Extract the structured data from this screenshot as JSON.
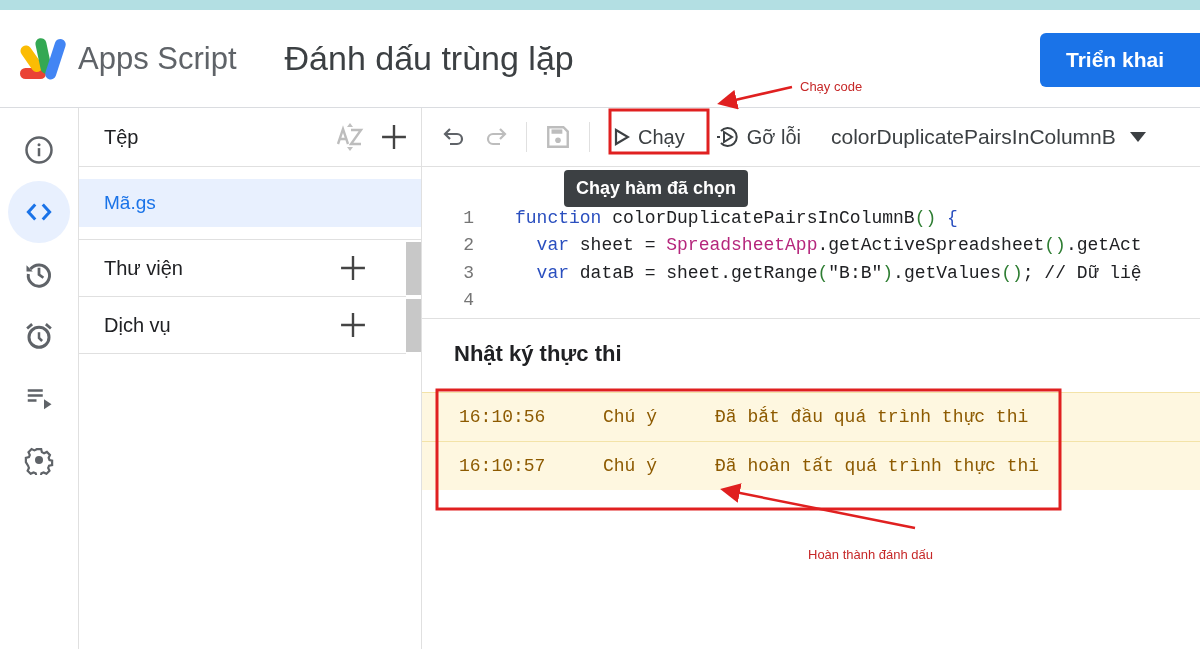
{
  "header": {
    "app_name": "Apps Script",
    "project_title": "Đánh dấu trùng lặp",
    "deploy_button": "Triển khai"
  },
  "rail_items": [
    {
      "kind": "info",
      "selected": false
    },
    {
      "kind": "code",
      "selected": true
    },
    {
      "kind": "history",
      "selected": false
    },
    {
      "kind": "triggers",
      "selected": false
    },
    {
      "kind": "executions",
      "selected": false
    },
    {
      "kind": "settings",
      "selected": false
    }
  ],
  "files_panel": {
    "title": "Tệp",
    "files": [
      {
        "name": "Mã.gs",
        "selected": true
      }
    ],
    "sections": [
      {
        "label": "Thư viện"
      },
      {
        "label": "Dịch vụ"
      }
    ]
  },
  "toolbar": {
    "undo_disabled": false,
    "redo_disabled": true,
    "save_disabled": true,
    "run_button": "Chạy",
    "debug_button": "Gỡ lỗi",
    "function_select": "colorDuplicatePairsInColumnB"
  },
  "tooltip": "Chạy hàm đã chọn",
  "code_lines": [
    {
      "number": "1",
      "tokens": [
        {
          "kind": "keyword",
          "text": "function"
        },
        {
          "kind": "plain",
          "text": " colorDuplicatePairsInColumnB"
        },
        {
          "kind": "paren",
          "text": "()"
        },
        {
          "kind": "keyword",
          "text": " {"
        }
      ]
    },
    {
      "number": "2",
      "tokens": [
        {
          "kind": "keyword",
          "text": "  var"
        },
        {
          "kind": "plain",
          "text": " sheet = "
        },
        {
          "kind": "class",
          "text": "SpreadsheetApp"
        },
        {
          "kind": "plain",
          "text": ".getActiveSpreadsheet"
        },
        {
          "kind": "paren",
          "text": "()"
        },
        {
          "kind": "plain",
          "text": ".getAct"
        }
      ]
    },
    {
      "number": "3",
      "tokens": [
        {
          "kind": "keyword",
          "text": "  var"
        },
        {
          "kind": "plain",
          "text": " dataB = sheet.getRange"
        },
        {
          "kind": "paren",
          "text": "("
        },
        {
          "kind": "string",
          "text": "\"B:B\""
        },
        {
          "kind": "paren",
          "text": ")"
        },
        {
          "kind": "plain",
          "text": ".getValues"
        },
        {
          "kind": "paren",
          "text": "()"
        },
        {
          "kind": "plain",
          "text": "; // Dữ liệ"
        }
      ]
    },
    {
      "number": "4"
    }
  ],
  "log": {
    "title": "Nhật ký thực thi",
    "entries": [
      {
        "time": "16:10:56",
        "level": "Chú ý",
        "message": "Đã bắt đầu quá trình thực thi"
      },
      {
        "time": "16:10:57",
        "level": "Chú ý",
        "message": "Đã hoàn tất quá trình thực thi"
      }
    ]
  },
  "annotations": {
    "run_callout": "Chạy code",
    "log_callout": "Hoàn thành đánh dấu"
  }
}
